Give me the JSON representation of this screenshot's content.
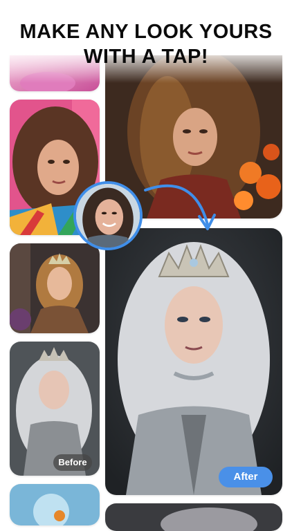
{
  "headline": {
    "line1": "MAKE ANY LOOK YOURS",
    "line2": "WITH A TAP!"
  },
  "labels": {
    "before": "Before",
    "after": "After"
  },
  "colors": {
    "accent": "#3f8ee9",
    "after_badge": "#4a90e8",
    "before_badge": "#4a4a4a"
  },
  "images": [
    "top-left-partial-photo",
    "curly-hair-colorful-top-photo",
    "orange-flowers-curly-hair-photo",
    "smiling-selfie-avatar",
    "princess-with-tiara-thumbnail",
    "silver-hair-queen-before-photo",
    "silver-hair-queen-after-photo",
    "bottom-left-partial-photo",
    "bottom-right-partial-photo"
  ]
}
